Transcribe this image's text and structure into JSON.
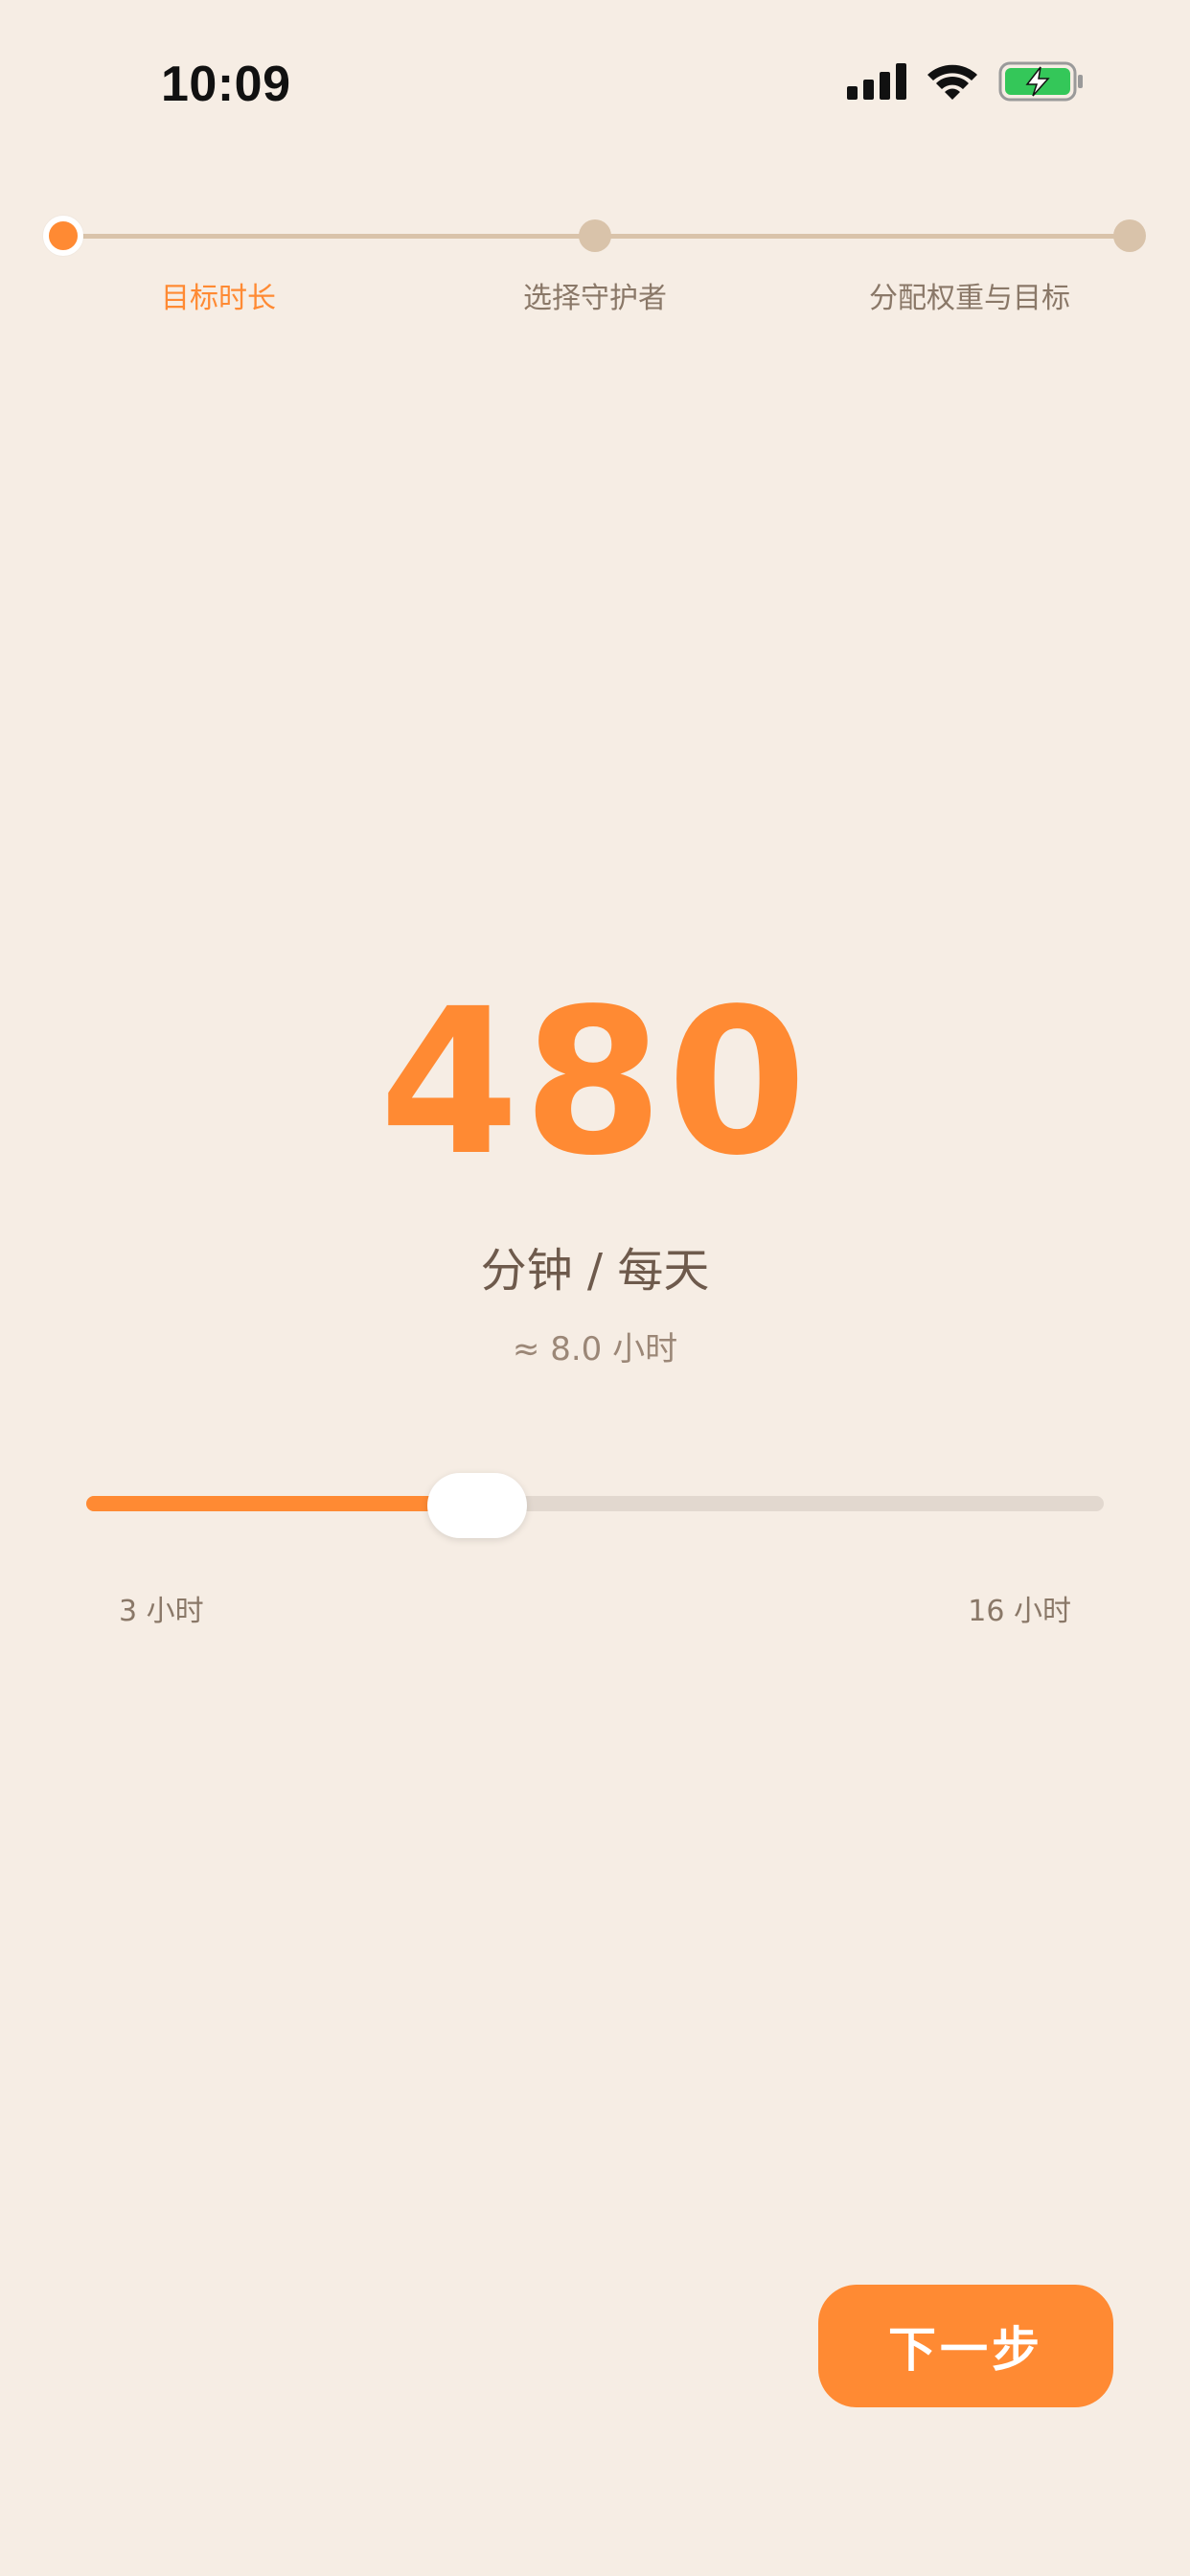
{
  "status_bar": {
    "time": "10:09",
    "icons": [
      "cellular-signal-icon",
      "wifi-icon",
      "battery-charging-icon"
    ],
    "battery_color": "#34C759"
  },
  "stepper": {
    "steps": [
      {
        "label": "目标时长",
        "active": true
      },
      {
        "label": "选择守护者",
        "active": false
      },
      {
        "label": "分配权重与目标",
        "active": false
      }
    ]
  },
  "goal": {
    "minutes": "480",
    "unit": "分钟 / 每天",
    "approx": "≈ 8.0 小时"
  },
  "slider": {
    "min_label": "3 小时",
    "max_label": "16 小时",
    "min_hours": 3,
    "max_hours": 16,
    "value_hours": 8.0
  },
  "actions": {
    "next_label": "下一步"
  },
  "colors": {
    "accent": "#FF8A33",
    "background": "#F6EDE4",
    "inactive": "#D9C3AA"
  }
}
